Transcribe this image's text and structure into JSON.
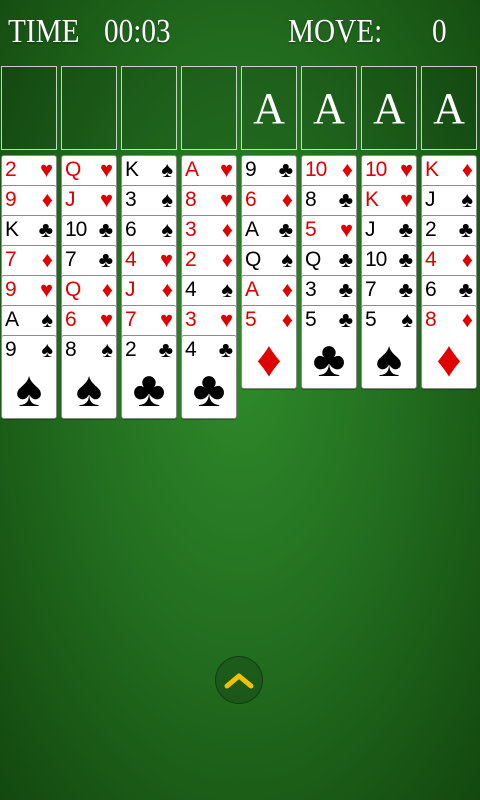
{
  "hud": {
    "time_label": "TIME",
    "time_value": "00:03",
    "move_label": "MOVE:",
    "move_value": "0"
  },
  "foundations": [
    "A",
    "A",
    "A",
    "A"
  ],
  "colors": {
    "felt": "#236f20",
    "red": "#e00000",
    "black": "#000000",
    "chevron": "#f2c200"
  },
  "tableau": [
    [
      {
        "rank": "2",
        "suit": "♥"
      },
      {
        "rank": "9",
        "suit": "♦"
      },
      {
        "rank": "K",
        "suit": "♣"
      },
      {
        "rank": "7",
        "suit": "♦"
      },
      {
        "rank": "9",
        "suit": "♥"
      },
      {
        "rank": "A",
        "suit": "♠"
      },
      {
        "rank": "9",
        "suit": "♠"
      }
    ],
    [
      {
        "rank": "Q",
        "suit": "♥"
      },
      {
        "rank": "J",
        "suit": "♥"
      },
      {
        "rank": "10",
        "suit": "♣"
      },
      {
        "rank": "7",
        "suit": "♣"
      },
      {
        "rank": "Q",
        "suit": "♦"
      },
      {
        "rank": "6",
        "suit": "♥"
      },
      {
        "rank": "8",
        "suit": "♠"
      }
    ],
    [
      {
        "rank": "K",
        "suit": "♠"
      },
      {
        "rank": "3",
        "suit": "♠"
      },
      {
        "rank": "6",
        "suit": "♠"
      },
      {
        "rank": "4",
        "suit": "♥"
      },
      {
        "rank": "J",
        "suit": "♦"
      },
      {
        "rank": "7",
        "suit": "♥"
      },
      {
        "rank": "2",
        "suit": "♣"
      }
    ],
    [
      {
        "rank": "A",
        "suit": "♥"
      },
      {
        "rank": "8",
        "suit": "♥"
      },
      {
        "rank": "3",
        "suit": "♦"
      },
      {
        "rank": "2",
        "suit": "♦"
      },
      {
        "rank": "4",
        "suit": "♠"
      },
      {
        "rank": "3",
        "suit": "♥"
      },
      {
        "rank": "4",
        "suit": "♣"
      }
    ],
    [
      {
        "rank": "9",
        "suit": "♣"
      },
      {
        "rank": "6",
        "suit": "♦"
      },
      {
        "rank": "A",
        "suit": "♣"
      },
      {
        "rank": "Q",
        "suit": "♠"
      },
      {
        "rank": "A",
        "suit": "♦"
      },
      {
        "rank": "5",
        "suit": "♦"
      }
    ],
    [
      {
        "rank": "10",
        "suit": "♦"
      },
      {
        "rank": "8",
        "suit": "♣"
      },
      {
        "rank": "5",
        "suit": "♥"
      },
      {
        "rank": "Q",
        "suit": "♣"
      },
      {
        "rank": "3",
        "suit": "♣"
      },
      {
        "rank": "5",
        "suit": "♣"
      }
    ],
    [
      {
        "rank": "10",
        "suit": "♥"
      },
      {
        "rank": "K",
        "suit": "♥"
      },
      {
        "rank": "J",
        "suit": "♣"
      },
      {
        "rank": "10",
        "suit": "♣"
      },
      {
        "rank": "7",
        "suit": "♣"
      },
      {
        "rank": "5",
        "suit": "♠"
      }
    ],
    [
      {
        "rank": "K",
        "suit": "♦"
      },
      {
        "rank": "J",
        "suit": "♠"
      },
      {
        "rank": "2",
        "suit": "♣"
      },
      {
        "rank": "4",
        "suit": "♦"
      },
      {
        "rank": "6",
        "suit": "♣"
      },
      {
        "rank": "8",
        "suit": "♦"
      }
    ]
  ],
  "controls": {
    "expand_icon": "chevron-up-icon"
  }
}
